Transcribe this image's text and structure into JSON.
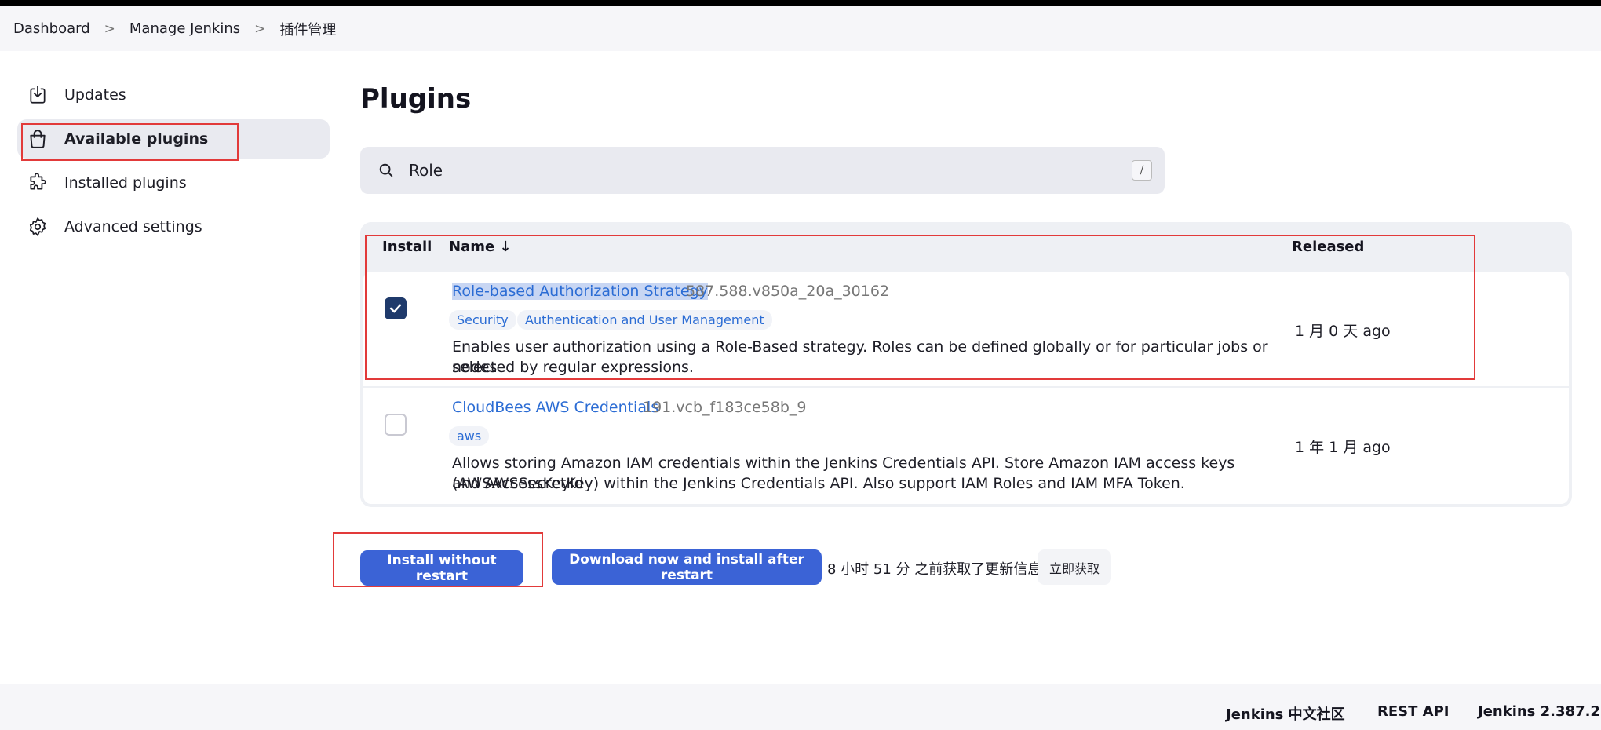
{
  "breadcrumb": [
    "Dashboard",
    "Manage Jenkins",
    "插件管理"
  ],
  "sidebar": {
    "items": [
      {
        "label": "Updates",
        "icon": "download-icon"
      },
      {
        "label": "Available plugins",
        "icon": "shopping-bag-icon",
        "active": true
      },
      {
        "label": "Installed plugins",
        "icon": "puzzle-icon"
      },
      {
        "label": "Advanced settings",
        "icon": "gear-icon"
      }
    ]
  },
  "main": {
    "title": "Plugins",
    "search": {
      "value": "Role",
      "shortcut": "/"
    },
    "table": {
      "headers": {
        "install": "Install",
        "name": "Name ↓",
        "released": "Released"
      },
      "rows": [
        {
          "checked": true,
          "name": "Role-based Authorization Strategy",
          "version": "587.588.v850a_20a_30162",
          "tags": [
            "Security",
            "Authentication and User Management"
          ],
          "description_line1": "Enables user authorization using a Role-Based strategy. Roles can be defined globally or for particular jobs or nodes",
          "description_line2": "selected by regular expressions.",
          "released": "1 月 0 天 ago"
        },
        {
          "checked": false,
          "name": "CloudBees AWS Credentials",
          "version": "191.vcb_f183ce58b_9",
          "tags": [
            "aws"
          ],
          "description_line1": "Allows storing Amazon IAM credentials within the Jenkins Credentials API. Store Amazon IAM access keys (AWSAccessKeyId",
          "description_line2": "and AWSSecretKey) within the Jenkins Credentials API. Also support IAM Roles and IAM MFA Token.",
          "released": "1 年 1 月 ago"
        }
      ]
    },
    "actions": {
      "install_without_restart": "Install without restart",
      "download_install_after_restart": "Download now and install after restart",
      "update_info": "8 小时 51 分 之前获取了更新信息",
      "fetch_now": "立即获取"
    }
  },
  "footer": {
    "community": "Jenkins 中文社区",
    "rest_api": "REST API",
    "version": "Jenkins 2.387.2"
  },
  "colors": {
    "accent": "#3b63d6",
    "link": "#2b6cd4",
    "annotation": "#e23a3a",
    "checkbox_checked": "#1f3a6b"
  }
}
